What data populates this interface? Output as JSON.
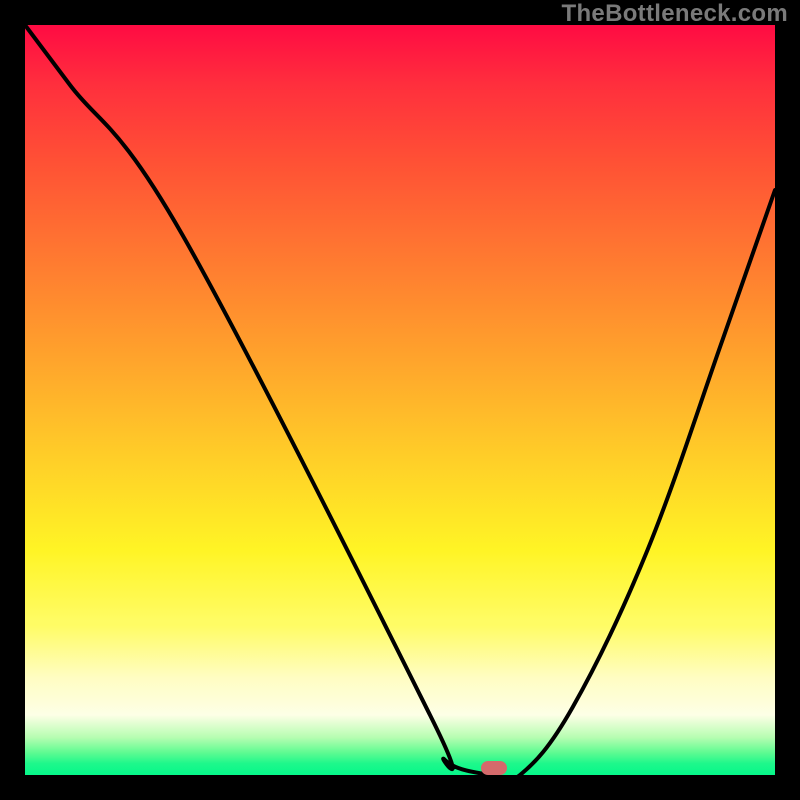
{
  "watermark": "TheBottleneck.com",
  "chart_data": {
    "type": "line",
    "title": "",
    "xlabel": "",
    "ylabel": "",
    "xlim": [
      0,
      1
    ],
    "ylim": [
      0,
      1
    ],
    "series": [
      {
        "name": "bottleneck-curve",
        "x": [
          0.0,
          0.06,
          0.21,
          0.54,
          0.56,
          0.62,
          0.66,
          0.73,
          0.83,
          0.93,
          1.0
        ],
        "y": [
          1.0,
          0.92,
          0.72,
          0.08,
          0.02,
          0.0,
          0.0,
          0.09,
          0.3,
          0.58,
          0.78
        ]
      }
    ],
    "marker": {
      "x": 0.625,
      "y": 0.01
    },
    "gradient_stops": [
      {
        "pct": 0,
        "color": "#ff0b43"
      },
      {
        "pct": 8,
        "color": "#ff2f3d"
      },
      {
        "pct": 18,
        "color": "#ff5035"
      },
      {
        "pct": 30,
        "color": "#ff7631"
      },
      {
        "pct": 44,
        "color": "#ffa22c"
      },
      {
        "pct": 58,
        "color": "#ffcf28"
      },
      {
        "pct": 70,
        "color": "#fff425"
      },
      {
        "pct": 80,
        "color": "#fffc64"
      },
      {
        "pct": 87,
        "color": "#fffdc2"
      },
      {
        "pct": 92,
        "color": "#fdffe6"
      },
      {
        "pct": 95,
        "color": "#b6fdb1"
      },
      {
        "pct": 97,
        "color": "#5ffb92"
      },
      {
        "pct": 98.5,
        "color": "#1df88b"
      },
      {
        "pct": 100,
        "color": "#06f78a"
      }
    ]
  },
  "colors": {
    "frame": "#000000",
    "curve": "#000000",
    "marker": "#d46a6b",
    "watermark": "#7a7a7a"
  }
}
